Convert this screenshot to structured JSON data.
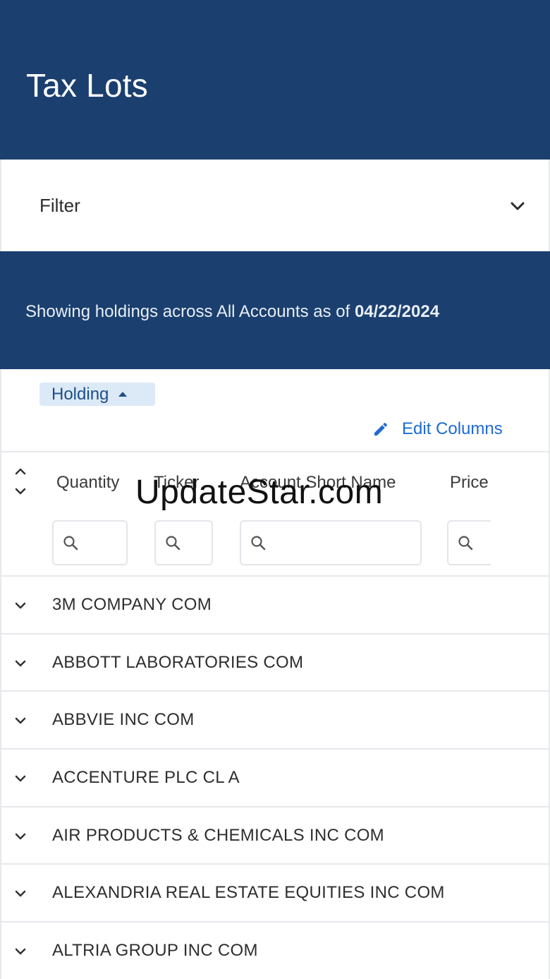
{
  "header": {
    "title": "Tax Lots"
  },
  "filter": {
    "label": "Filter",
    "icon": "chevron-down-icon"
  },
  "banner": {
    "prefix": "Showing holdings across All Accounts as of ",
    "date": "04/22/2024"
  },
  "group_chip": {
    "label": "Holding",
    "icon": "caret-up-icon"
  },
  "toolbar": {
    "edit_columns_label": "Edit Columns",
    "edit_icon": "pencil-icon"
  },
  "table": {
    "columns": [
      {
        "label": "Quantity"
      },
      {
        "label": "Ticker"
      },
      {
        "label": "Account Short Name"
      },
      {
        "label": "Price"
      }
    ],
    "rows": [
      {
        "label": "3M COMPANY COM"
      },
      {
        "label": "ABBOTT LABORATORIES COM"
      },
      {
        "label": "ABBVIE INC COM"
      },
      {
        "label": "ACCENTURE PLC CL A"
      },
      {
        "label": "AIR PRODUCTS & CHEMICALS INC COM"
      },
      {
        "label": "ALEXANDRIA REAL ESTATE EQUITIES INC COM"
      },
      {
        "label": "ALTRIA GROUP INC COM"
      }
    ]
  },
  "watermark": {
    "text": "UpdateStar.com"
  },
  "colors": {
    "header_bg": "#1b3f6e",
    "chip_bg": "#dce9f7",
    "link": "#1f6bd1"
  }
}
